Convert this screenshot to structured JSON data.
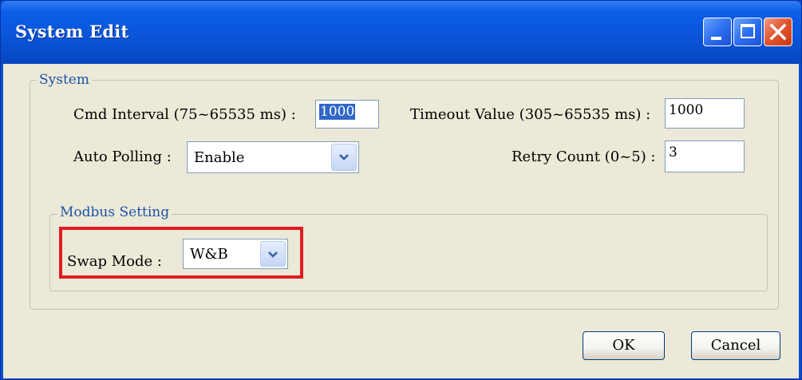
{
  "window": {
    "title": "System Edit",
    "controls": {
      "minimize_icon": "minimize-icon",
      "maximize_icon": "maximize-icon",
      "close_icon": "close-icon"
    }
  },
  "system_group": {
    "legend": "System",
    "cmd_interval": {
      "label": "Cmd Interval (75~65535 ms) :",
      "value": "1000"
    },
    "timeout_value": {
      "label": "Timeout Value (305~65535 ms) :",
      "value": "1000"
    },
    "auto_polling": {
      "label": "Auto Polling :",
      "value": "Enable"
    },
    "retry_count": {
      "label": "Retry Count (0~5) :",
      "value": "3"
    }
  },
  "modbus_group": {
    "legend": "Modbus Setting",
    "swap_mode": {
      "label": "Swap Mode :",
      "value": "W&B"
    }
  },
  "buttons": {
    "ok": "OK",
    "cancel": "Cancel"
  },
  "colors": {
    "title_bar": "#0a55da",
    "dialog_background": "#ece9d8",
    "group_legend": "#1c52a6",
    "highlight_border": "#e11b23",
    "selection": "#3168c8"
  }
}
